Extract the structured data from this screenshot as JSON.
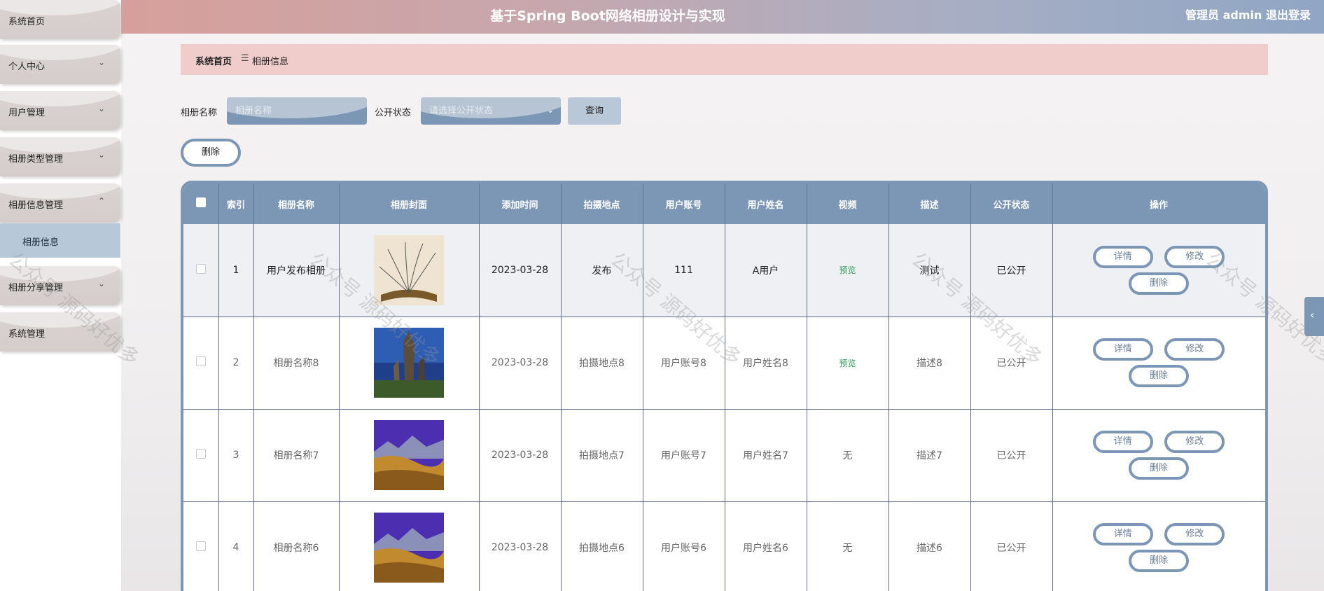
{
  "header": {
    "title": "基于Spring Boot网络相册设计与实现",
    "user": "管理员 admin",
    "logout": "退出登录"
  },
  "sidebar": {
    "items": [
      {
        "label": "系统首页",
        "chev": ""
      },
      {
        "label": "个人中心",
        "chev": "⌄"
      },
      {
        "label": "用户管理",
        "chev": "⌄"
      },
      {
        "label": "相册类型管理",
        "chev": "⌄"
      },
      {
        "label": "相册信息管理",
        "chev": "⌃"
      },
      {
        "label": "相册分享管理",
        "chev": "⌄"
      },
      {
        "label": "系统管理",
        "chev": ""
      }
    ],
    "active_sub": "相册信息"
  },
  "breadcrumb": {
    "home": "系统首页",
    "sep": "☰",
    "current": "相册信息"
  },
  "search": {
    "name_label": "相册名称",
    "name_placeholder": "相册名称",
    "status_label": "公开状态",
    "status_placeholder": "请选择公开状态",
    "query_button": "查询"
  },
  "toolbar": {
    "delete_button": "删除"
  },
  "table": {
    "columns": [
      "索引",
      "相册名称",
      "相册封面",
      "添加时间",
      "拍摄地点",
      "用户账号",
      "用户姓名",
      "视频",
      "描述",
      "公开状态",
      "操作"
    ],
    "rows": [
      {
        "index": "1",
        "name": "用户发布相册",
        "cover": "book",
        "time": "2023-03-28",
        "place": "发布",
        "account": "111",
        "username": "A用户",
        "video": "预览",
        "desc": "测试",
        "status": "已公开"
      },
      {
        "index": "2",
        "name": "相册名称8",
        "cover": "rocks",
        "time": "2023-03-28",
        "place": "拍摄地点8",
        "account": "用户账号8",
        "username": "用户姓名8",
        "video": "预览",
        "desc": "描述8",
        "status": "已公开"
      },
      {
        "index": "3",
        "name": "相册名称7",
        "cover": "mountain",
        "time": "2023-03-28",
        "place": "拍摄地点7",
        "account": "用户账号7",
        "username": "用户姓名7",
        "video": "无",
        "desc": "描述7",
        "status": "已公开"
      },
      {
        "index": "4",
        "name": "相册名称6",
        "cover": "mountain",
        "time": "2023-03-28",
        "place": "拍摄地点6",
        "account": "用户账号6",
        "username": "用户姓名6",
        "video": "无",
        "desc": "描述6",
        "status": "已公开"
      }
    ],
    "ops": {
      "detail": "详情",
      "edit": "修改",
      "delete": "删除"
    }
  },
  "watermark": "公众号 源码好优多",
  "colors": {
    "accent": "#7c97b6",
    "header_start": "#d79f9b",
    "breadcrumb_bg": "#f0cccb",
    "preview_link": "#2a9a5b"
  }
}
